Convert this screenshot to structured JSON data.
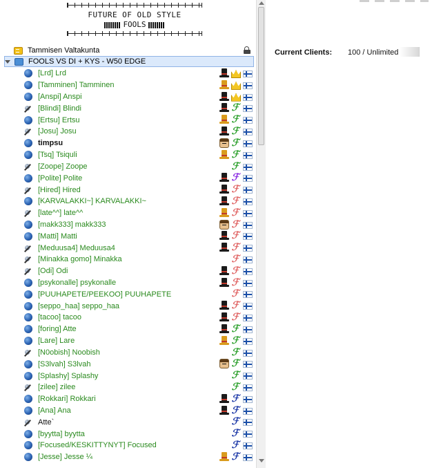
{
  "banner": {
    "line1": "FUTURE OF OLD STYLE",
    "line2": "FOOLS"
  },
  "server": {
    "name": "Tammisen Valtakunta"
  },
  "channel": {
    "name": "FOOLS VS DI + KYS - W50 EDGE"
  },
  "clients": [
    {
      "name": "[Lrd] Lrd",
      "status": "ball",
      "style": "green",
      "badges": [
        "hat-black",
        "crown",
        "flag"
      ]
    },
    {
      "name": "[Tamminen] Tamminen",
      "status": "ball",
      "style": "green",
      "badges": [
        "hat-gold",
        "crown",
        "flag"
      ]
    },
    {
      "name": "[Anspi] Anspi",
      "status": "ball",
      "style": "green",
      "badges": [
        "hat-black",
        "crown",
        "flag"
      ]
    },
    {
      "name": "[Blindi] Blindi",
      "status": "mute",
      "style": "green",
      "badges": [
        "hat-black",
        "f-green",
        "flag"
      ]
    },
    {
      "name": "[Ertsu] Ertsu",
      "status": "ball",
      "style": "green",
      "badges": [
        "hat-gold",
        "f-green",
        "flag"
      ]
    },
    {
      "name": "[Josu] Josu",
      "status": "mute",
      "style": "green",
      "badges": [
        "hat-black",
        "f-green",
        "flag"
      ]
    },
    {
      "name": "timpsu",
      "status": "ball",
      "style": "black",
      "badges": [
        "face",
        "f-green",
        "flag"
      ]
    },
    {
      "name": "[Tsq] Tsiquli",
      "status": "ball",
      "style": "green",
      "badges": [
        "hat-gold",
        "f-green",
        "flag"
      ]
    },
    {
      "name": "[Zoope] Zoope",
      "status": "mute",
      "style": "green",
      "badges": [
        "f-green",
        "flag"
      ]
    },
    {
      "name": "[Polite] Polite",
      "status": "ball",
      "style": "green",
      "badges": [
        "hat-black",
        "f-purple",
        "flag"
      ]
    },
    {
      "name": "[Hired] Hired",
      "status": "mute",
      "style": "green",
      "badges": [
        "hat-black",
        "f-red",
        "flag"
      ]
    },
    {
      "name": "[KARVALAKKI~] KARVALAKKI~",
      "status": "ball",
      "style": "green",
      "badges": [
        "hat-black",
        "f-red",
        "flag"
      ]
    },
    {
      "name": "[late^^] late^^",
      "status": "mute",
      "style": "green",
      "badges": [
        "hat-gold",
        "f-red",
        "flag"
      ]
    },
    {
      "name": "[makk333] makk333",
      "status": "ball",
      "style": "green",
      "badges": [
        "face",
        "f-red",
        "flag"
      ]
    },
    {
      "name": "[Matti] Matti",
      "status": "ball",
      "style": "green",
      "badges": [
        "hat-black",
        "f-red",
        "flag"
      ]
    },
    {
      "name": "[Meduusa4] Meduusa4",
      "status": "mute",
      "style": "green",
      "badges": [
        "hat-black",
        "f-red",
        "flag"
      ]
    },
    {
      "name": "[Minakka gomo] Minakka",
      "status": "mute",
      "style": "green",
      "badges": [
        "f-red",
        "flag"
      ]
    },
    {
      "name": "[Odi] Odi",
      "status": "mute",
      "style": "green",
      "badges": [
        "hat-black",
        "f-red",
        "flag"
      ]
    },
    {
      "name": "[psykonalle] psykonalle",
      "status": "ball",
      "style": "green",
      "badges": [
        "hat-black",
        "f-red",
        "flag"
      ]
    },
    {
      "name": "[PUUHAPETE/PEEKOO] PUUHAPETE",
      "status": "ball",
      "style": "green",
      "badges": [
        "f-red",
        "flag"
      ]
    },
    {
      "name": "[seppo_haa] seppo_haa",
      "status": "ball",
      "style": "green",
      "badges": [
        "hat-black",
        "f-red",
        "flag"
      ]
    },
    {
      "name": "[tacoo] tacoo",
      "status": "ball",
      "style": "green",
      "badges": [
        "hat-black",
        "f-red",
        "flag"
      ]
    },
    {
      "name": "[foring] Atte",
      "status": "ball",
      "style": "green",
      "badges": [
        "hat-black",
        "f-green",
        "flag"
      ]
    },
    {
      "name": "[Lare] Lare",
      "status": "ball",
      "style": "green",
      "badges": [
        "hat-gold",
        "f-green",
        "flag"
      ]
    },
    {
      "name": "[N0obish] Noobish",
      "status": "mute",
      "style": "green",
      "badges": [
        "f-green",
        "flag"
      ]
    },
    {
      "name": "[S3lvah] S3lvah",
      "status": "ball",
      "style": "green",
      "badges": [
        "face",
        "f-green",
        "flag"
      ]
    },
    {
      "name": "[Splashy] Splashy",
      "status": "ball",
      "style": "green",
      "badges": [
        "f-green",
        "flag"
      ]
    },
    {
      "name": "[zilee] zilee",
      "status": "mute",
      "style": "green",
      "badges": [
        "f-green",
        "flag"
      ]
    },
    {
      "name": "[Rokkari] Rokkari",
      "status": "ball",
      "style": "green",
      "badges": [
        "hat-black",
        "f-blue",
        "flag"
      ]
    },
    {
      "name": "[Ana] Ana",
      "status": "ball",
      "style": "green",
      "badges": [
        "hat-black",
        "f-blue",
        "flag"
      ]
    },
    {
      "name": "Atte`",
      "status": "mute",
      "style": "plain",
      "badges": [
        "f-blue",
        "flag"
      ]
    },
    {
      "name": "[byytta] byytta",
      "status": "ball",
      "style": "green",
      "badges": [
        "f-blue",
        "flag"
      ]
    },
    {
      "name": "[Focused/KESKITTYNYT] Focused",
      "status": "ball",
      "style": "green",
      "badges": [
        "f-blue",
        "flag"
      ]
    },
    {
      "name": "[Jesse] Jesse ¼",
      "status": "ball",
      "style": "green",
      "badges": [
        "hat-gold",
        "f-blue",
        "flag"
      ]
    }
  ],
  "info": {
    "label": "Current Clients:",
    "value": "100 / Unlimited"
  }
}
